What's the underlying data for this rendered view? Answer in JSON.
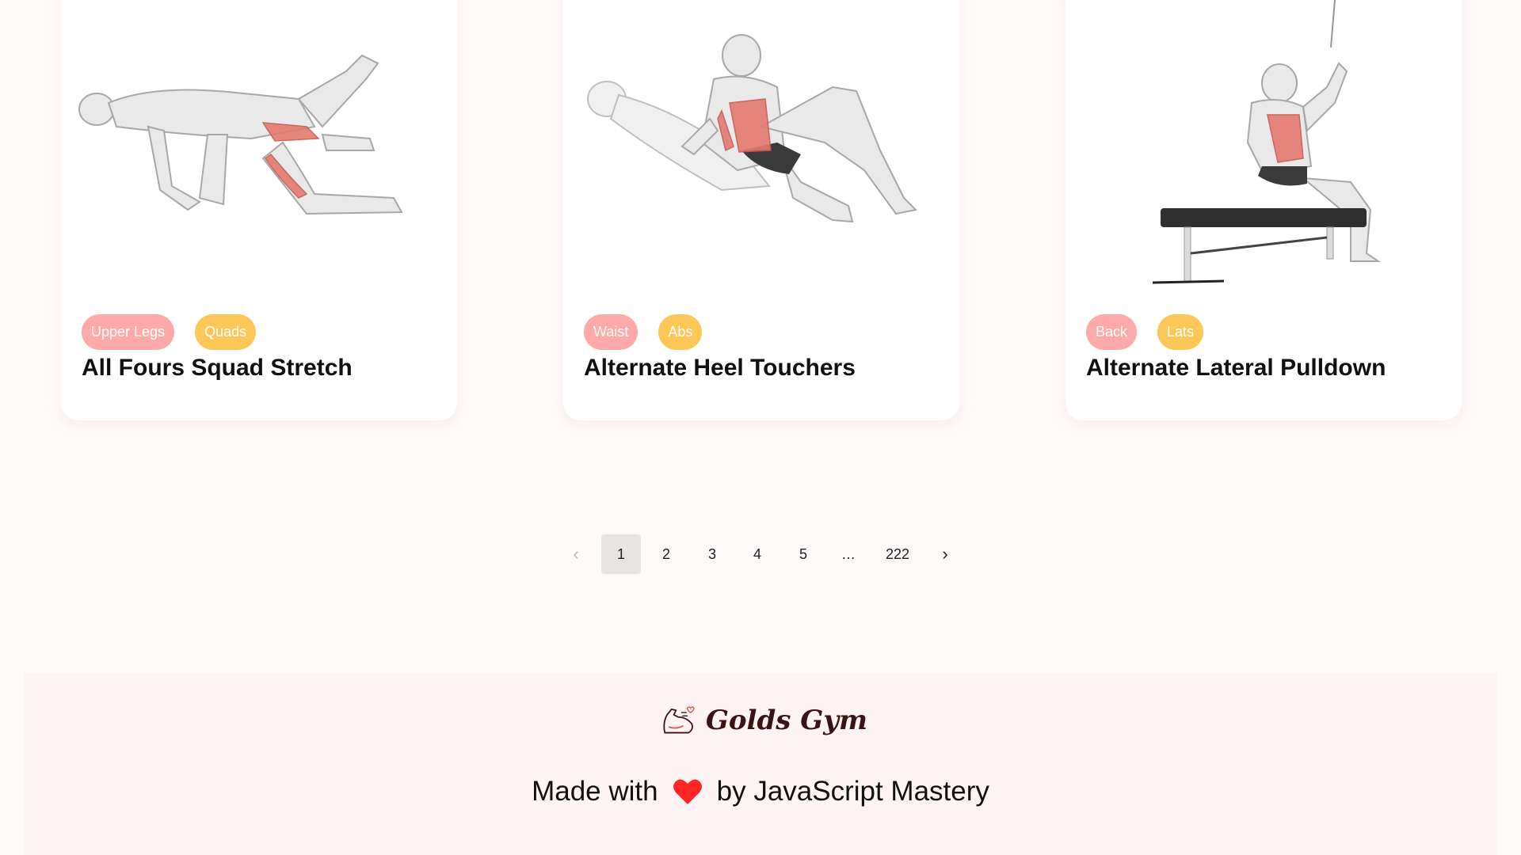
{
  "exercises": [
    {
      "body_part": "Upper Legs",
      "target": "Quads",
      "name": "All Fours Squad Stretch"
    },
    {
      "body_part": "Waist",
      "target": "Abs",
      "name": "Alternate Heel Touchers"
    },
    {
      "body_part": "Back",
      "target": "Lats",
      "name": "Alternate Lateral Pulldown"
    }
  ],
  "pagination": {
    "prev_icon": "chevron-left-icon",
    "next_icon": "chevron-right-icon",
    "pages": [
      "1",
      "2",
      "3",
      "4",
      "5"
    ],
    "ellipsis": "…",
    "last": "222",
    "current": "1"
  },
  "footer": {
    "brand": "Golds Gym",
    "made_with_prefix": "Made with",
    "made_with_suffix": "by JavaScript Mastery"
  },
  "colors": {
    "page_bg": "#fffafa",
    "card_bg": "#ffffff",
    "body_part_tag": "#ffa9a9",
    "target_tag": "#fcc757",
    "footer_bg": "#fff3f3",
    "heart": "#ff2625",
    "brand_text": "#3a1414"
  }
}
